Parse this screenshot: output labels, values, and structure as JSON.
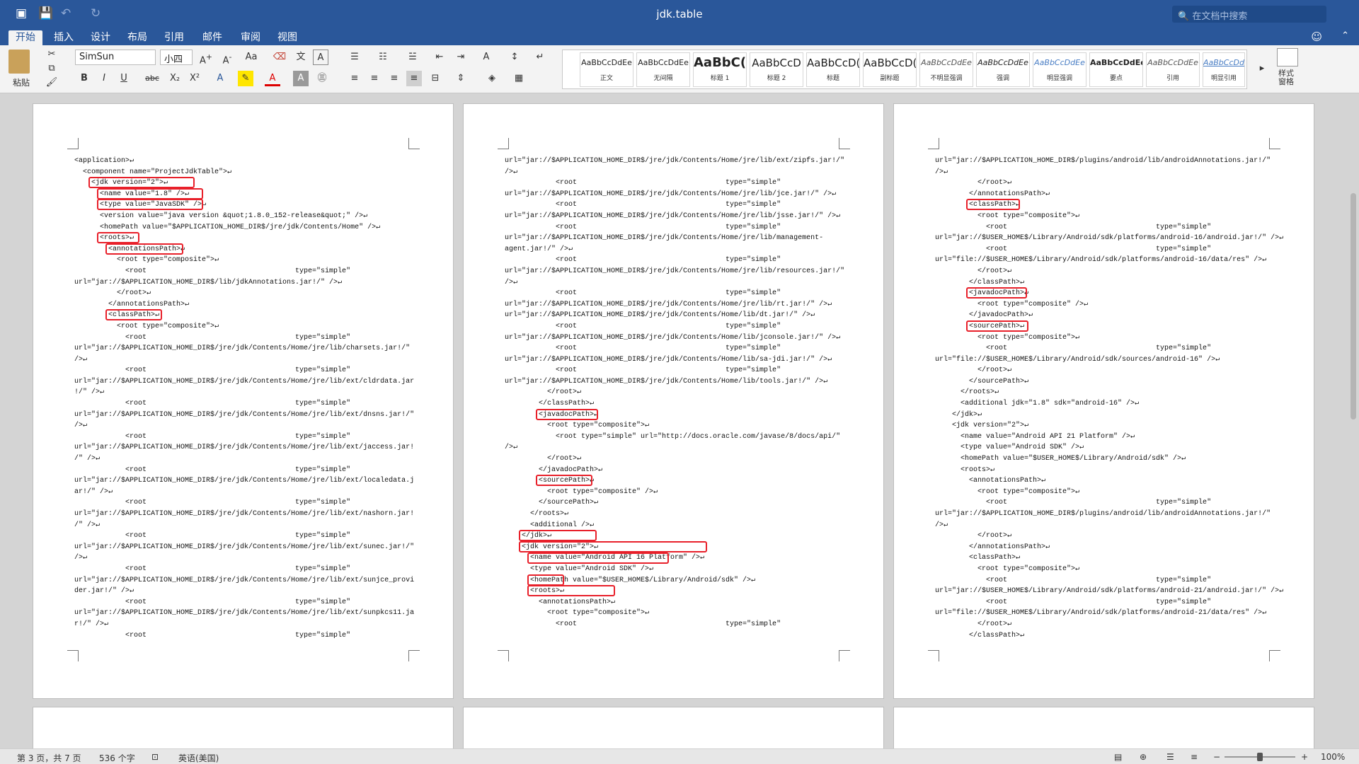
{
  "window": {
    "title": "jdk.table",
    "search_placeholder": "在文档中搜索"
  },
  "tabs": [
    "开始",
    "插入",
    "设计",
    "布局",
    "引用",
    "邮件",
    "审阅",
    "视图"
  ],
  "ribbon": {
    "paste_label": "粘贴",
    "font_name": "SimSun",
    "font_size": "小四",
    "styles": [
      {
        "preview": "AaBbCcDdEe",
        "name": "正文"
      },
      {
        "preview": "AaBbCcDdEe",
        "name": "无间隔"
      },
      {
        "preview": "AaBbC(",
        "name": "标题 1"
      },
      {
        "preview": "AaBbCcD",
        "name": "标题 2"
      },
      {
        "preview": "AaBbCcD(",
        "name": "标题"
      },
      {
        "preview": "AaBbCcD(",
        "name": "副标题"
      },
      {
        "preview": "AaBbCcDdEe",
        "name": "不明显强调"
      },
      {
        "preview": "AaBbCcDdEe",
        "name": "强调"
      },
      {
        "preview": "AaBbCcDdEe",
        "name": "明显强调"
      },
      {
        "preview": "AaBbCcDdEe",
        "name": "要点"
      },
      {
        "preview": "AaBbCcDdEe",
        "name": "引用"
      },
      {
        "preview": "AaBbCcDdEe",
        "name": "明显引用"
      }
    ],
    "styles_pane_label": "样式\n窗格"
  },
  "pages": [
    {
      "lines": [
        "<application>↵",
        "  <component name=\"ProjectJdkTable\">↵",
        "    <jdk version=\"2\">↵",
        "      <name value=\"1.8\" />↵",
        "      <type value=\"JavaSDK\" />↵",
        "      <version value=\"java version &quot;1.8.0_152-release&quot;\" />↵",
        "      <homePath value=\"$APPLICATION_HOME_DIR$/jre/jdk/Contents/Home\" />↵",
        "      <roots>↵",
        "        <annotationsPath>↵",
        "          <root type=\"composite\">↵",
        "            <root                                   type=\"simple\"",
        "url=\"jar://$APPLICATION_HOME_DIR$/lib/jdkAnnotations.jar!/\" />↵",
        "          </root>↵",
        "        </annotationsPath>↵",
        "        <classPath>↵",
        "          <root type=\"composite\">↵",
        "            <root                                   type=\"simple\"",
        "url=\"jar://$APPLICATION_HOME_DIR$/jre/jdk/Contents/Home/jre/lib/charsets.jar!/\"",
        "/>↵",
        "            <root                                   type=\"simple\"",
        "url=\"jar://$APPLICATION_HOME_DIR$/jre/jdk/Contents/Home/jre/lib/ext/cldrdata.jar",
        "!/\" />↵",
        "            <root                                   type=\"simple\"",
        "url=\"jar://$APPLICATION_HOME_DIR$/jre/jdk/Contents/Home/jre/lib/ext/dnsns.jar!/\"",
        "/>↵",
        "            <root                                   type=\"simple\"",
        "url=\"jar://$APPLICATION_HOME_DIR$/jre/jdk/Contents/Home/jre/lib/ext/jaccess.jar!",
        "/\" />↵",
        "            <root                                   type=\"simple\"",
        "url=\"jar://$APPLICATION_HOME_DIR$/jre/jdk/Contents/Home/jre/lib/ext/localedata.j",
        "ar!/\" />↵",
        "            <root                                   type=\"simple\"",
        "url=\"jar://$APPLICATION_HOME_DIR$/jre/jdk/Contents/Home/jre/lib/ext/nashorn.jar!",
        "/\" />↵",
        "            <root                                   type=\"simple\"",
        "url=\"jar://$APPLICATION_HOME_DIR$/jre/jdk/Contents/Home/jre/lib/ext/sunec.jar!/\"",
        "/>↵",
        "            <root                                   type=\"simple\"",
        "url=\"jar://$APPLICATION_HOME_DIR$/jre/jdk/Contents/Home/jre/lib/ext/sunjce_provi",
        "der.jar!/\" />↵",
        "            <root                                   type=\"simple\"",
        "url=\"jar://$APPLICATION_HOME_DIR$/jre/jdk/Contents/Home/jre/lib/ext/sunpkcs11.ja",
        "r!/\" />↵",
        "            <root                                   type=\"simple\""
      ]
    },
    {
      "lines": [
        "url=\"jar://$APPLICATION_HOME_DIR$/jre/jdk/Contents/Home/jre/lib/ext/zipfs.jar!/\"",
        "/>↵",
        "            <root                                   type=\"simple\"",
        "url=\"jar://$APPLICATION_HOME_DIR$/jre/jdk/Contents/Home/jre/lib/jce.jar!/\" />↵",
        "            <root                                   type=\"simple\"",
        "url=\"jar://$APPLICATION_HOME_DIR$/jre/jdk/Contents/Home/jre/lib/jsse.jar!/\" />↵",
        "            <root                                   type=\"simple\"",
        "url=\"jar://$APPLICATION_HOME_DIR$/jre/jdk/Contents/Home/jre/lib/management-",
        "agent.jar!/\" />↵",
        "            <root                                   type=\"simple\"",
        "url=\"jar://$APPLICATION_HOME_DIR$/jre/jdk/Contents/Home/jre/lib/resources.jar!/\"",
        "/>↵",
        "            <root                                   type=\"simple\"",
        "url=\"jar://$APPLICATION_HOME_DIR$/jre/jdk/Contents/Home/jre/lib/rt.jar!/\" />↵",
        "url=\"jar://$APPLICATION_HOME_DIR$/jre/jdk/Contents/Home/lib/dt.jar!/\" />↵",
        "            <root                                   type=\"simple\"",
        "url=\"jar://$APPLICATION_HOME_DIR$/jre/jdk/Contents/Home/lib/jconsole.jar!/\" />↵",
        "            <root                                   type=\"simple\"",
        "url=\"jar://$APPLICATION_HOME_DIR$/jre/jdk/Contents/Home/lib/sa-jdi.jar!/\" />↵",
        "            <root                                   type=\"simple\"",
        "url=\"jar://$APPLICATION_HOME_DIR$/jre/jdk/Contents/Home/lib/tools.jar!/\" />↵",
        "          </root>↵",
        "        </classPath>↵",
        "        <javadocPath>↵",
        "          <root type=\"composite\">↵",
        "            <root type=\"simple\" url=\"http://docs.oracle.com/javase/8/docs/api/\"",
        "/>↵",
        "          </root>↵",
        "        </javadocPath>↵",
        "        <sourcePath>↵",
        "          <root type=\"composite\" />↵",
        "        </sourcePath>↵",
        "      </roots>↵",
        "      <additional />↵",
        "    </jdk>↵",
        "    <jdk version=\"2\">↵",
        "      <name value=\"Android API 16 Platform\" />↵",
        "      <type value=\"Android SDK\" />↵",
        "      <homePath value=\"$USER_HOME$/Library/Android/sdk\" />↵",
        "      <roots>↵",
        "        <annotationsPath>↵",
        "          <root type=\"composite\">↵",
        "            <root                                   type=\"simple\""
      ]
    },
    {
      "lines": [
        "url=\"jar://$APPLICATION_HOME_DIR$/plugins/android/lib/androidAnnotations.jar!/\"",
        "/>↵",
        "          </root>↵",
        "        </annotationsPath>↵",
        "        <classPath>↵",
        "          <root type=\"composite\">↵",
        "            <root                                   type=\"simple\"",
        "url=\"jar://$USER_HOME$/Library/Android/sdk/platforms/android-16/android.jar!/\" />↵",
        "            <root                                   type=\"simple\"",
        "url=\"file://$USER_HOME$/Library/Android/sdk/platforms/android-16/data/res\" />↵",
        "          </root>↵",
        "        </classPath>↵",
        "        <javadocPath>↵",
        "          <root type=\"composite\" />↵",
        "        </javadocPath>↵",
        "        <sourcePath>↵",
        "          <root type=\"composite\">↵",
        "            <root                                   type=\"simple\"",
        "url=\"file://$USER_HOME$/Library/Android/sdk/sources/android-16\" />↵",
        "          </root>↵",
        "        </sourcePath>↵",
        "      </roots>↵",
        "      <additional jdk=\"1.8\" sdk=\"android-16\" />↵",
        "    </jdk>↵",
        "    <jdk version=\"2\">↵",
        "      <name value=\"Android API 21 Platform\" />↵",
        "      <type value=\"Android SDK\" />↵",
        "      <homePath value=\"$USER_HOME$/Library/Android/sdk\" />↵",
        "      <roots>↵",
        "        <annotationsPath>↵",
        "          <root type=\"composite\">↵",
        "            <root                                   type=\"simple\"",
        "url=\"jar://$APPLICATION_HOME_DIR$/plugins/android/lib/androidAnnotations.jar!/\"",
        "/>↵",
        "          </root>↵",
        "        </annotationsPath>↵",
        "        <classPath>↵",
        "          <root type=\"composite\">↵",
        "            <root                                   type=\"simple\"",
        "url=\"jar://$USER_HOME$/Library/Android/sdk/platforms/android-21/android.jar!/\" />↵",
        "            <root                                   type=\"simple\"",
        "url=\"file://$USER_HOME$/Library/Android/sdk/platforms/android-21/data/res\" />↵",
        "          </root>↵",
        "        </classPath>↵"
      ]
    }
  ],
  "status": {
    "page_info": "第 3 页，共 7 页",
    "word_count": "536 个字",
    "language": "英语(美国)",
    "zoom": "100%"
  }
}
